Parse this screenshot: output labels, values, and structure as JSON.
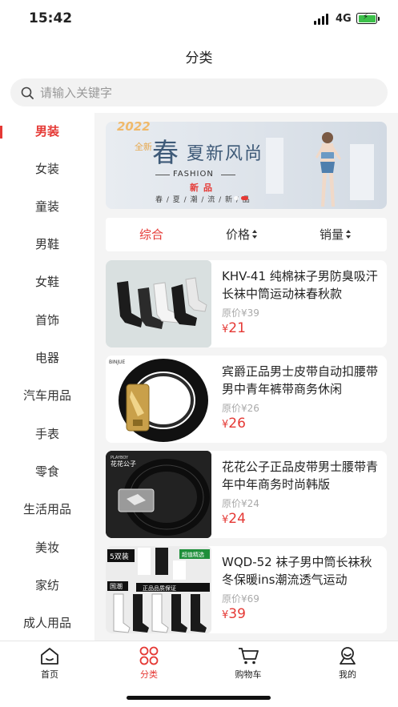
{
  "status_bar": {
    "time": "15:42",
    "network": "4G"
  },
  "header": {
    "title": "分类"
  },
  "search": {
    "placeholder": "请输入关键字"
  },
  "sidebar": {
    "items": [
      {
        "label": "男装",
        "active": true
      },
      {
        "label": "女装"
      },
      {
        "label": "童装"
      },
      {
        "label": "男鞋"
      },
      {
        "label": "女鞋"
      },
      {
        "label": "首饰"
      },
      {
        "label": "电器"
      },
      {
        "label": "汽车用品"
      },
      {
        "label": "手表"
      },
      {
        "label": "零食"
      },
      {
        "label": "生活用品"
      },
      {
        "label": "美妆"
      },
      {
        "label": "家纺"
      },
      {
        "label": "成人用品"
      }
    ]
  },
  "banner": {
    "year": "2022",
    "big_char": "春",
    "headline": "夏新风尚",
    "small": "全新",
    "fashion": "FASHION",
    "new_label": "新品",
    "tags": "春 / 夏 / 潮 / 流 / 新 / 品"
  },
  "sort": {
    "options": [
      {
        "label": "综合",
        "active": true
      },
      {
        "label": "价格"
      },
      {
        "label": "销量"
      }
    ]
  },
  "products": [
    {
      "title": "KHV-41 纯棉袜子男防臭吸汗长袜中筒运动袜春秋款",
      "orig_label": "原价",
      "orig_price": "¥39",
      "currency": "¥",
      "price": "21"
    },
    {
      "title": "宾爵正品男士皮带自动扣腰带男中青年裤带商务休闲",
      "orig_label": "原价",
      "orig_price": "¥26",
      "currency": "¥",
      "price": "26"
    },
    {
      "title": "花花公子正品皮带男士腰带青年中年商务时尚韩版",
      "orig_label": "原价",
      "orig_price": "¥24",
      "currency": "¥",
      "price": "24"
    },
    {
      "title": "WQD-52 袜子男中筒长袜秋冬保暖ins潮流透气运动",
      "orig_label": "原价",
      "orig_price": "¥69",
      "currency": "¥",
      "price": "39"
    }
  ],
  "thumb_text": {
    "belt1_brand": "BINJUE",
    "belt2_brand": "花花公子",
    "belt2_sub": "PLAYBOY",
    "socks_count": "5双装",
    "socks_tag": "国潮",
    "socks_quality": "正品品质保证",
    "socks_promo": "超值精选"
  },
  "tabbar": {
    "items": [
      {
        "label": "首页",
        "icon": "home-icon"
      },
      {
        "label": "分类",
        "icon": "category-icon",
        "active": true
      },
      {
        "label": "购物车",
        "icon": "cart-icon"
      },
      {
        "label": "我的",
        "icon": "user-icon"
      }
    ]
  },
  "colors": {
    "accent": "#e53935",
    "background": "#f4f4f4"
  }
}
